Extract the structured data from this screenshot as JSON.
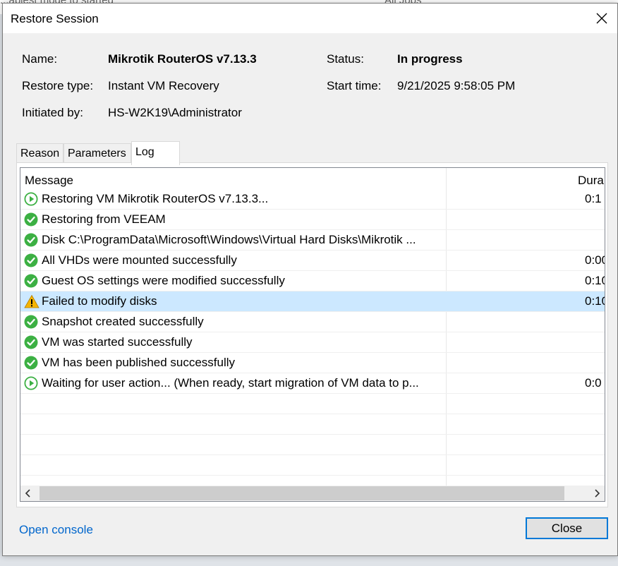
{
  "background": {
    "left_text": "...ablest mode to started",
    "right_text": "All Jobs"
  },
  "dialog": {
    "title": "Restore Session",
    "close_glyph": "×"
  },
  "info": {
    "name_label": "Name:",
    "name_value": "Mikrotik RouterOS v7.13.3",
    "restore_type_label": "Restore type:",
    "restore_type_value": "Instant VM Recovery",
    "initiated_by_label": "Initiated by:",
    "initiated_by_value": "HS-W2K19\\Administrator",
    "status_label": "Status:",
    "status_value": "In progress",
    "start_time_label": "Start time:",
    "start_time_value": "9/21/2025 9:58:05 PM"
  },
  "tabs": [
    {
      "label": "Reason",
      "active": false
    },
    {
      "label": "Parameters",
      "active": false
    },
    {
      "label": "Log",
      "active": true
    }
  ],
  "log": {
    "columns": {
      "message": "Message",
      "duration": "Dura"
    },
    "rows": [
      {
        "status": "running",
        "message": "Restoring VM Mikrotik RouterOS v7.13.3...",
        "duration": "0:1"
      },
      {
        "status": "success",
        "message": "Restoring from VEEAM",
        "duration": ""
      },
      {
        "status": "success",
        "message": "Disk C:\\ProgramData\\Microsoft\\Windows\\Virtual Hard Disks\\Mikrotik ...",
        "duration": ""
      },
      {
        "status": "success",
        "message": "All VHDs were mounted successfully",
        "duration": "0:00"
      },
      {
        "status": "success",
        "message": "Guest OS settings were modified successfully",
        "duration": "0:10"
      },
      {
        "status": "warning",
        "message": "Failed to modify disks",
        "duration": "0:10",
        "selected": true
      },
      {
        "status": "success",
        "message": "Snapshot created successfully",
        "duration": ""
      },
      {
        "status": "success",
        "message": "VM was started successfully",
        "duration": ""
      },
      {
        "status": "success",
        "message": "VM has been published successfully",
        "duration": ""
      },
      {
        "status": "running",
        "message": "Waiting for user action... (When ready, start migration of VM data to p...",
        "duration": "0:0"
      }
    ],
    "empty_rows": 5
  },
  "footer": {
    "open_console_label": "Open console",
    "close_label": "Close"
  },
  "colors": {
    "success": "#3cb043",
    "running_ring": "#3cb043",
    "warning": "#f5b400",
    "selected_row": "#cce8ff",
    "link": "#0066cc",
    "button_border": "#0078d7"
  }
}
